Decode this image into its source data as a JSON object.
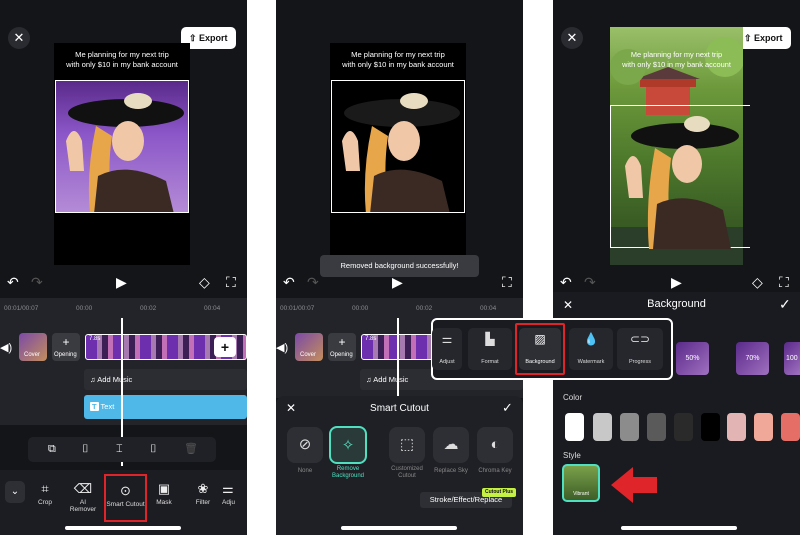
{
  "caption_line1": "Me planning for my next trip",
  "caption_line2": "with only $10 in my bank account",
  "export_label": "Export",
  "close_glyph": "✕",
  "panel1": {
    "ruler": [
      "00:01/00:07",
      "00:00",
      "00:02",
      "00:04"
    ],
    "cover_label": "Cover",
    "opening_label": "Opening",
    "clip_duration": "7.8s",
    "add_music": "Add Music",
    "text_track": "Text",
    "tools": [
      "Crop",
      "AI Remover",
      "Smart Cutout",
      "Mask",
      "Filter",
      "Adju"
    ]
  },
  "panel2": {
    "toast": "Removed background successfully!",
    "ruler": [
      "00:01/00:07",
      "00:00",
      "00:02",
      "00:04"
    ],
    "cover_label": "Cover",
    "opening_label": "Opening",
    "clip_duration": "7.8s",
    "add_music": "Add Music",
    "sheet_title": "Smart Cutout",
    "options": [
      "None",
      "Remove Background",
      "Customized Cutout",
      "Replace Sky",
      "Chroma Key"
    ],
    "stroke_btn": "Stroke/Effect/Replace",
    "plus_badge": "Cutout Plus"
  },
  "popup": {
    "items": [
      "Adjust",
      "Format",
      "Background",
      "Watermark",
      "Progress"
    ]
  },
  "panel3": {
    "title": "Background",
    "blur_options": [
      "50%",
      "70%",
      "100"
    ],
    "color_label": "Color",
    "style_label": "Style",
    "style_thumb_label": "Vibrant"
  },
  "colors": {
    "swatches": [
      "#ffffff",
      "#c8c8c8",
      "#8c8c8c",
      "#5a5a5a",
      "#2a2a2a",
      "#000000",
      "#e3b4b4",
      "#f0a898",
      "#e56e66"
    ],
    "highlight": "#e0252a",
    "accent": "#4fe0c0",
    "text_track": "#4fb8e8"
  }
}
